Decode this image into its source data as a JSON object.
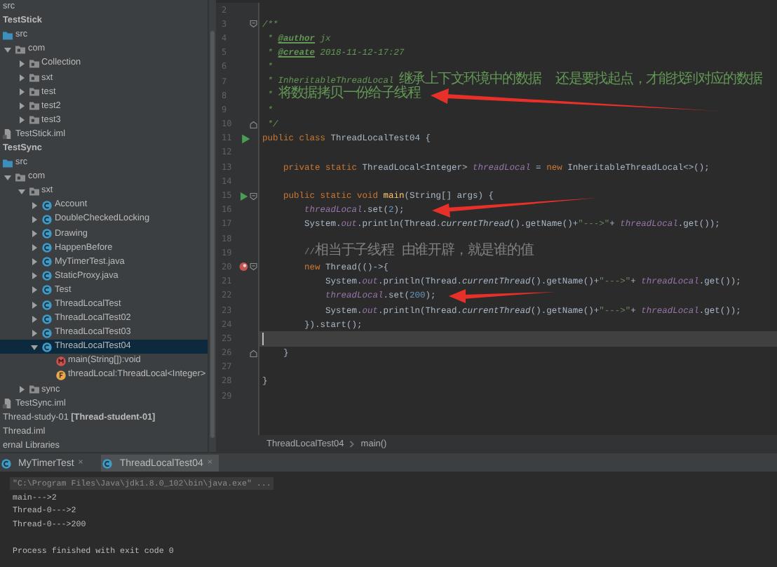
{
  "tree": {
    "items": [
      {
        "label": "src",
        "kind": "text",
        "selected": false
      },
      {
        "label": "TestStick",
        "kind": "module",
        "selected": false
      },
      {
        "label": "src",
        "kind": "source-folder",
        "selected": false
      },
      {
        "label": "com",
        "kind": "package",
        "selected": false,
        "expanded": true,
        "children": [
          {
            "label": "Collection",
            "kind": "package",
            "selected": false,
            "expanded": false
          },
          {
            "label": "sxt",
            "kind": "package",
            "selected": false,
            "expanded": false
          },
          {
            "label": "test",
            "kind": "package",
            "selected": false,
            "expanded": false
          },
          {
            "label": "test2",
            "kind": "package",
            "selected": false,
            "expanded": false
          },
          {
            "label": "test3",
            "kind": "package",
            "selected": false,
            "expanded": false
          }
        ]
      },
      {
        "label": "TestStick.iml",
        "kind": "iml",
        "selected": false
      },
      {
        "label": "TestSync",
        "kind": "module",
        "selected": false
      },
      {
        "label": "src",
        "kind": "source-folder",
        "selected": false
      },
      {
        "label": "com",
        "kind": "package",
        "selected": false,
        "expanded": true,
        "children": [
          {
            "label": "sxt",
            "kind": "package",
            "selected": false,
            "expanded": true,
            "children": [
              {
                "label": "Account",
                "kind": "class",
                "selected": false,
                "expanded": false
              },
              {
                "label": "DoubleCheckedLocking",
                "kind": "class",
                "selected": false,
                "expanded": false
              },
              {
                "label": "Drawing",
                "kind": "class",
                "selected": false,
                "expanded": false
              },
              {
                "label": "HappenBefore",
                "kind": "class",
                "selected": false,
                "expanded": false
              },
              {
                "label": "MyTimerTest.java",
                "kind": "class",
                "selected": false,
                "expanded": false
              },
              {
                "label": "StaticProxy.java",
                "kind": "class",
                "selected": false,
                "expanded": false
              },
              {
                "label": "Test",
                "kind": "class",
                "selected": false,
                "expanded": false
              },
              {
                "label": "ThreadLocalTest",
                "kind": "class",
                "selected": false,
                "expanded": false
              },
              {
                "label": "ThreadLocalTest02",
                "kind": "class",
                "selected": false,
                "expanded": false
              },
              {
                "label": "ThreadLocalTest03",
                "kind": "class",
                "selected": false,
                "expanded": false
              },
              {
                "label": "ThreadLocalTest04",
                "kind": "class",
                "selected": true,
                "expanded": true,
                "children": [
                  {
                    "label": "main(String[]):void",
                    "kind": "method",
                    "selected": false
                  },
                  {
                    "label": "threadLocal:ThreadLocal<Integer>",
                    "kind": "field",
                    "selected": false
                  }
                ]
              }
            ]
          },
          {
            "label": "sync",
            "kind": "package",
            "selected": false,
            "expanded": false
          }
        ]
      },
      {
        "label": "TestSync.iml",
        "kind": "iml",
        "selected": false
      },
      {
        "label": "Thread-study-01 **[Thread-student-01]**",
        "kind": "text",
        "selected": false
      },
      {
        "label": "Thread.iml",
        "kind": "text",
        "selected": false
      },
      {
        "label": "ernal Libraries",
        "kind": "text",
        "selected": false
      }
    ]
  },
  "editor": {
    "lines": [
      {
        "number": "2"
      },
      {
        "number": "3",
        "fold_start": true,
        "tokens": [
          {
            "kind": "doc",
            "text": "/**"
          }
        ]
      },
      {
        "number": "4",
        "tokens": [
          {
            "kind": "doc",
            "text": " * "
          },
          {
            "kind": "tag",
            "text": "@author"
          },
          {
            "kind": "doc",
            "text": " jx"
          }
        ]
      },
      {
        "number": "5",
        "tokens": [
          {
            "kind": "doc",
            "text": " * "
          },
          {
            "kind": "tag",
            "text": "@create"
          },
          {
            "kind": "doc",
            "text": " 2018-11-12-17:27"
          }
        ]
      },
      {
        "number": "6",
        "tokens": [
          {
            "kind": "doc",
            "text": " *"
          }
        ]
      },
      {
        "number": "7",
        "tokens": [
          {
            "kind": "doc",
            "text": " * InheritableThreadLocal "
          },
          {
            "kind": "doc-cjk",
            "text": "继承上下文环境中的数据"
          },
          {
            "kind": "doc-cjk",
            "text": "  还是要找起点，才能找到对应的数据"
          }
        ]
      },
      {
        "number": "8",
        "tokens": [
          {
            "kind": "doc",
            "text": " * "
          },
          {
            "kind": "doc-cjk",
            "text": "将数据拷贝一份给子线程"
          }
        ]
      },
      {
        "number": "9",
        "tokens": [
          {
            "kind": "doc",
            "text": " *"
          }
        ]
      },
      {
        "number": "10",
        "fold_end": true,
        "tokens": [
          {
            "kind": "doc",
            "text": " */"
          }
        ]
      },
      {
        "number": "11",
        "runnable": true,
        "tokens": [
          {
            "kind": "keyword",
            "text": "public class "
          },
          {
            "kind": "plain",
            "text": "ThreadLocalTest04 {"
          }
        ]
      },
      {
        "number": "12"
      },
      {
        "number": "13",
        "tokens": [
          {
            "kind": "keyword",
            "text": "    private static "
          },
          {
            "kind": "plain",
            "text": "ThreadLocal<Integer> "
          },
          {
            "kind": "field",
            "text": "threadLocal"
          },
          {
            "kind": "plain",
            "text": " = "
          },
          {
            "kind": "keyword",
            "text": "new "
          },
          {
            "kind": "plain",
            "text": "InheritableThreadLocal<>();"
          }
        ]
      },
      {
        "number": "14"
      },
      {
        "number": "15",
        "runnable": true,
        "fold_start": true,
        "tokens": [
          {
            "kind": "keyword",
            "text": "    public static void "
          },
          {
            "kind": "method-decl",
            "text": "main"
          },
          {
            "kind": "plain",
            "text": "(String[] args) {"
          }
        ]
      },
      {
        "number": "16",
        "tokens": [
          {
            "kind": "field",
            "text": "        threadLocal"
          },
          {
            "kind": "plain",
            "text": ".set("
          },
          {
            "kind": "number",
            "text": "2"
          },
          {
            "kind": "plain",
            "text": ");"
          }
        ]
      },
      {
        "number": "17",
        "tokens": [
          {
            "kind": "plain",
            "text": "        System."
          },
          {
            "kind": "field",
            "text": "out"
          },
          {
            "kind": "plain",
            "text": ".println(Thread."
          },
          {
            "kind": "static-call",
            "text": "currentThread"
          },
          {
            "kind": "plain",
            "text": "().getName()+"
          },
          {
            "kind": "string",
            "text": "\"--->\""
          },
          {
            "kind": "plain",
            "text": "+ "
          },
          {
            "kind": "field",
            "text": "threadLocal"
          },
          {
            "kind": "plain",
            "text": ".get());"
          }
        ]
      },
      {
        "number": "18"
      },
      {
        "number": "19",
        "tokens": [
          {
            "kind": "comment",
            "text": "        //"
          },
          {
            "kind": "comment-cjk",
            "text": "相当于子线程 由谁开辟，就是谁的值"
          }
        ]
      },
      {
        "number": "20",
        "breakpoint": true,
        "fold_start": true,
        "tokens": [
          {
            "kind": "keyword",
            "text": "        new "
          },
          {
            "kind": "plain",
            "text": "Thread(()->{"
          }
        ]
      },
      {
        "number": "21",
        "tokens": [
          {
            "kind": "plain",
            "text": "            System."
          },
          {
            "kind": "field",
            "text": "out"
          },
          {
            "kind": "plain",
            "text": ".println(Thread."
          },
          {
            "kind": "static-call",
            "text": "currentThread"
          },
          {
            "kind": "plain",
            "text": "().getName()+"
          },
          {
            "kind": "string",
            "text": "\"--->\""
          },
          {
            "kind": "plain",
            "text": "+ "
          },
          {
            "kind": "field",
            "text": "threadLocal"
          },
          {
            "kind": "plain",
            "text": ".get());"
          }
        ]
      },
      {
        "number": "22",
        "tokens": [
          {
            "kind": "field",
            "text": "            threadLocal"
          },
          {
            "kind": "plain",
            "text": ".set("
          },
          {
            "kind": "number",
            "text": "200"
          },
          {
            "kind": "plain",
            "text": ");"
          }
        ]
      },
      {
        "number": "23",
        "tokens": [
          {
            "kind": "plain",
            "text": "            System."
          },
          {
            "kind": "field",
            "text": "out"
          },
          {
            "kind": "plain",
            "text": ".println(Thread."
          },
          {
            "kind": "static-call",
            "text": "currentThread"
          },
          {
            "kind": "plain",
            "text": "().getName()+"
          },
          {
            "kind": "string",
            "text": "\"--->\""
          },
          {
            "kind": "plain",
            "text": "+ "
          },
          {
            "kind": "field",
            "text": "threadLocal"
          },
          {
            "kind": "plain",
            "text": ".get());"
          }
        ]
      },
      {
        "number": "24",
        "tokens": [
          {
            "kind": "plain",
            "text": "        }).start();"
          }
        ]
      },
      {
        "number": "25",
        "current": true
      },
      {
        "number": "26",
        "fold_end": true,
        "tokens": [
          {
            "kind": "plain",
            "text": "    }"
          }
        ]
      },
      {
        "number": "27"
      },
      {
        "number": "28",
        "tokens": [
          {
            "kind": "plain",
            "text": "}"
          }
        ]
      },
      {
        "number": "29"
      }
    ],
    "breadcrumbs": [
      "ThreadLocalTest04",
      "main()"
    ]
  },
  "run_tabs": [
    {
      "label": "MyTimerTest",
      "close": "×",
      "selected": false
    },
    {
      "label": "ThreadLocalTest04",
      "close": "×",
      "selected": true
    }
  ],
  "console": {
    "lines": [
      {
        "kind": "command",
        "text": "\"C:\\Program Files\\Java\\jdk1.8.0_102\\bin\\java.exe\" ..."
      },
      {
        "kind": "output",
        "text": "main--->2"
      },
      {
        "kind": "output",
        "text": "Thread-0--->2"
      },
      {
        "kind": "output",
        "text": "Thread-0--->200"
      },
      {
        "kind": "exit",
        "text": "Process finished with exit code 0"
      }
    ]
  }
}
